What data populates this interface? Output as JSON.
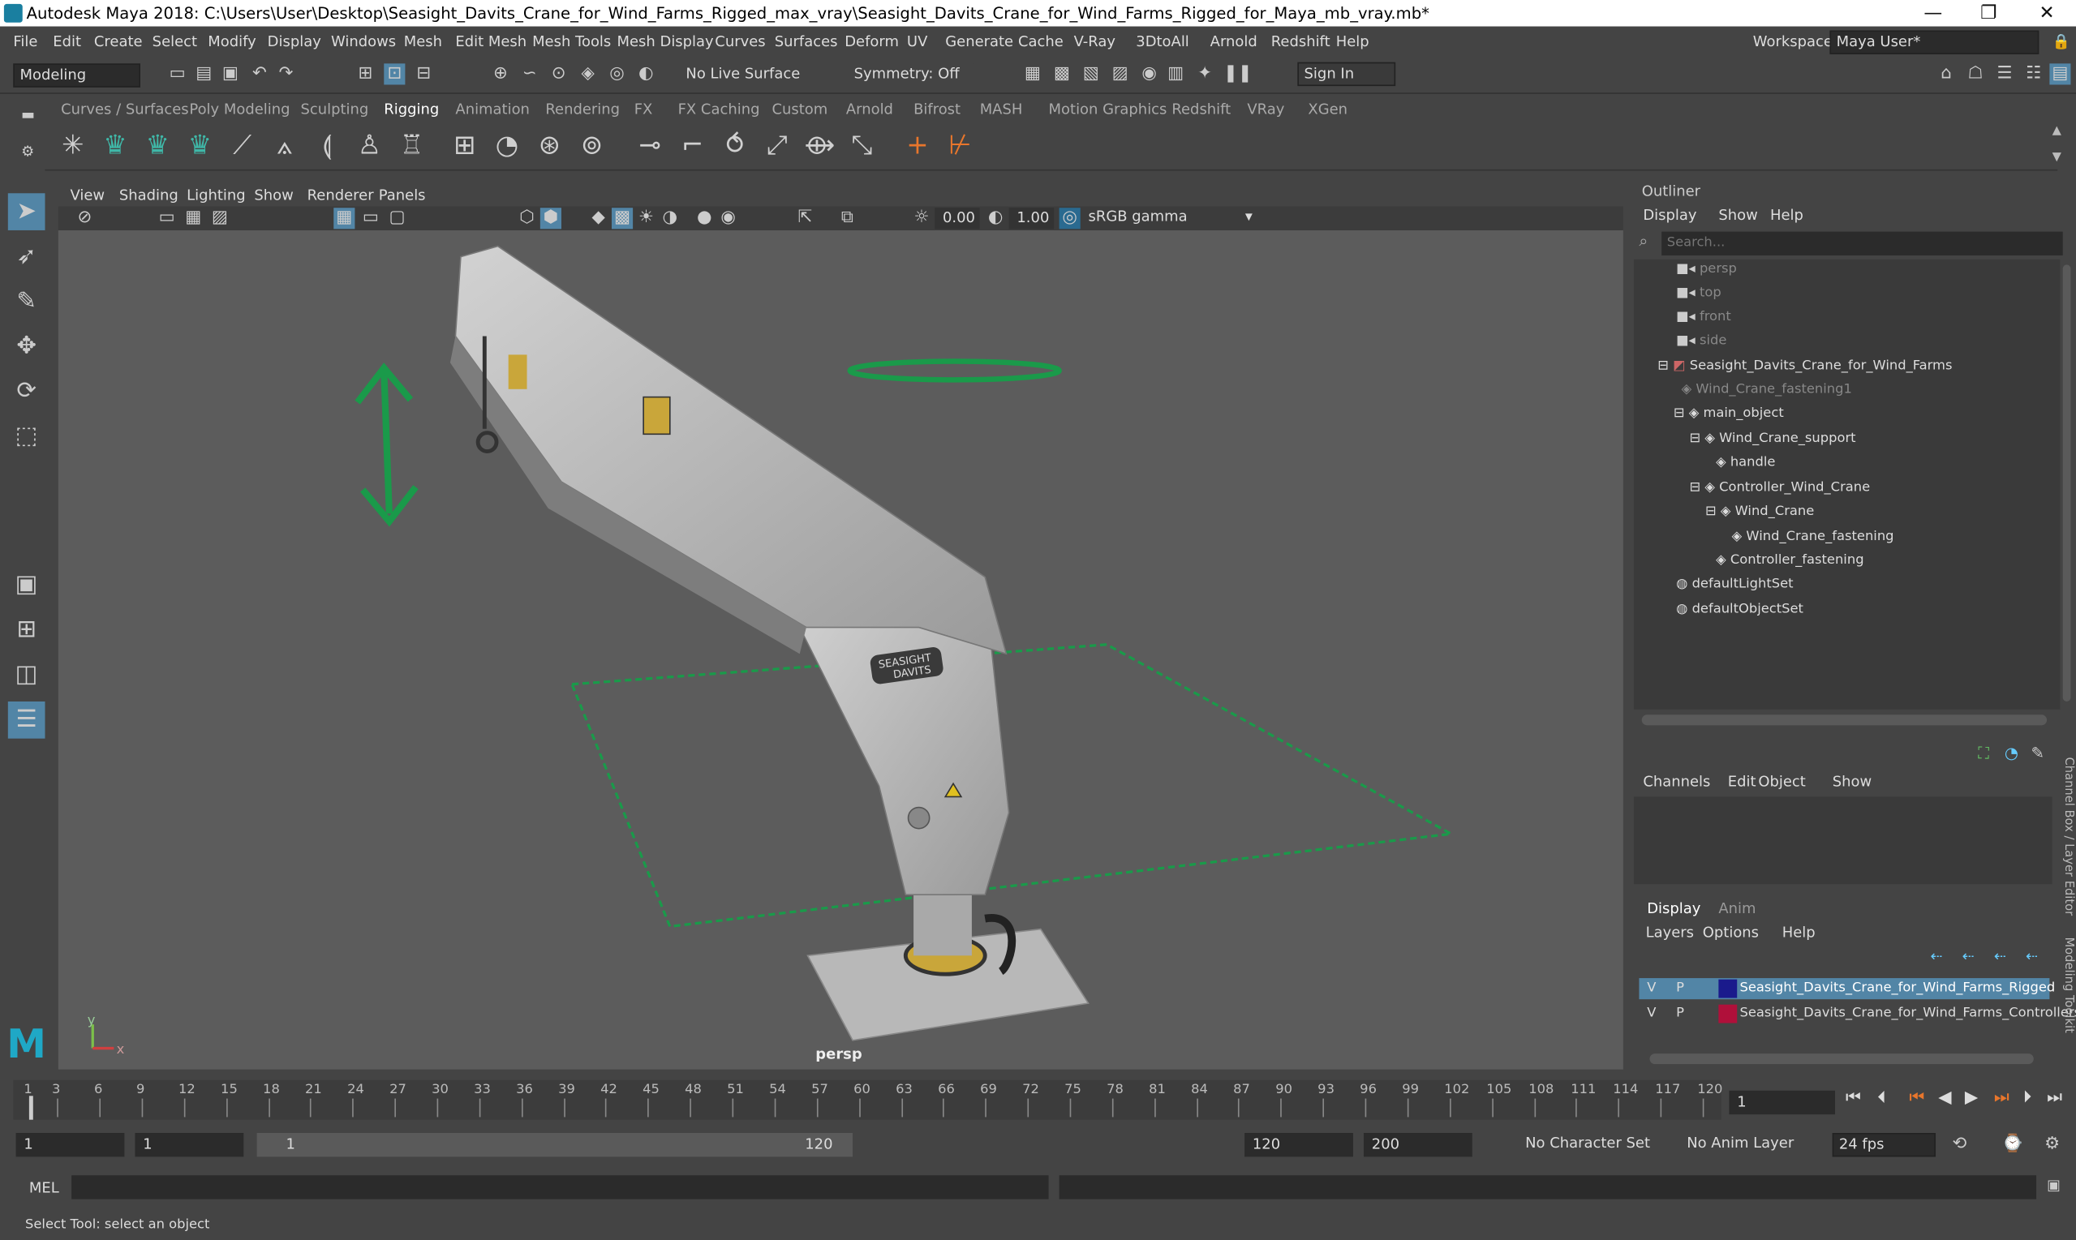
{
  "window": {
    "title": "Autodesk Maya 2018: C:\\Users\\User\\Desktop\\Seasight_Davits_Crane_for_Wind_Farms_Rigged_max_vray\\Seasight_Davits_Crane_for_Wind_Farms_Rigged_for_Maya_mb_vray.mb*",
    "minimize": "—",
    "maximize": "❐",
    "close": "✕"
  },
  "menus": [
    "File",
    "Edit",
    "Create",
    "Select",
    "Modify",
    "Display",
    "Windows",
    "Mesh",
    "Edit Mesh",
    "Mesh Tools",
    "Mesh Display",
    "Curves",
    "Surfaces",
    "Deform",
    "UV",
    "Generate",
    "Cache",
    "V-Ray",
    "3DtoAll",
    "Arnold",
    "Redshift",
    "Help"
  ],
  "workspace": {
    "label": "Workspace :",
    "value": "Maya User*"
  },
  "status": {
    "mode": "Modeling",
    "live_surface": "No Live Surface",
    "symmetry": "Symmetry: Off",
    "sign_in": "Sign In"
  },
  "shelf_tabs": [
    "Curves / Surfaces",
    "Poly Modeling",
    "Sculpting",
    "Rigging",
    "Animation",
    "Rendering",
    "FX",
    "FX Caching",
    "Custom",
    "Arnold",
    "Bifrost",
    "MASH",
    "Motion Graphics",
    "Redshift",
    "VRay",
    "XGen"
  ],
  "viewport": {
    "menus": [
      "View",
      "Shading",
      "Lighting",
      "Show",
      "Renderer",
      "Panels"
    ],
    "exposure": "0.00",
    "gamma": "1.00",
    "color_space": "sRGB gamma",
    "camera_label": "persp",
    "axis_x": "x",
    "axis_y": "y",
    "sign_text_1": "SEASIGHT",
    "sign_text_2": "DAVITS"
  },
  "outliner": {
    "title": "Outliner",
    "menus": [
      "Display",
      "Show",
      "Help"
    ],
    "search_placeholder": "Search...",
    "items": [
      {
        "label": "persp"
      },
      {
        "label": "top"
      },
      {
        "label": "front"
      },
      {
        "label": "side"
      },
      {
        "label": "Seasight_Davits_Crane_for_Wind_Farms"
      },
      {
        "label": "Wind_Crane_fastening1"
      },
      {
        "label": "main_object"
      },
      {
        "label": "Wind_Crane_support"
      },
      {
        "label": "handle"
      },
      {
        "label": "Controller_Wind_Crane"
      },
      {
        "label": "Wind_Crane"
      },
      {
        "label": "Wind_Crane_fastening"
      },
      {
        "label": "Controller_fastening"
      },
      {
        "label": "defaultLightSet"
      },
      {
        "label": "defaultObjectSet"
      }
    ]
  },
  "channel_box": {
    "menus": [
      "Channels",
      "Edit",
      "Object",
      "Show"
    ],
    "side_label": "Channel Box / Layer Editor",
    "side_label2": "Modeling Toolkit"
  },
  "layer_editor": {
    "tabs": [
      "Display",
      "Anim"
    ],
    "menus": [
      "Layers",
      "Options",
      "Help"
    ],
    "layers": [
      {
        "v": "V",
        "p": "P",
        "name": "Seasight_Davits_Crane_for_Wind_Farms_Rigged",
        "color": "#1a1a8c"
      },
      {
        "v": "V",
        "p": "P",
        "name": "Seasight_Davits_Crane_for_Wind_Farms_Controllers",
        "color": "#b0103a"
      }
    ]
  },
  "timeline": {
    "ticks": [
      "1",
      "3",
      "6",
      "9",
      "12",
      "15",
      "18",
      "21",
      "24",
      "27",
      "30",
      "33",
      "36",
      "39",
      "42",
      "45",
      "48",
      "51",
      "54",
      "57",
      "60",
      "63",
      "66",
      "69",
      "72",
      "75",
      "78",
      "81",
      "84",
      "87",
      "90",
      "93",
      "96",
      "99",
      "102",
      "105",
      "108",
      "111",
      "114",
      "117",
      "120"
    ],
    "current_frame": "1"
  },
  "range": {
    "start": "1",
    "playback_start": "1",
    "slider_start": "1",
    "slider_end": "120",
    "playback_end": "120",
    "end": "200",
    "character_set": "No Character Set",
    "anim_layer": "No Anim Layer",
    "fps": "24 fps"
  },
  "command": {
    "label": "MEL"
  },
  "help_line": "Select Tool: select an object"
}
